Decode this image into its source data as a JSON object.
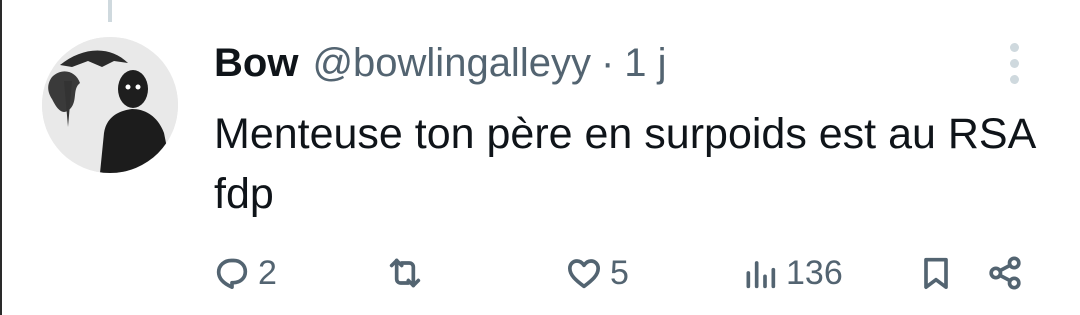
{
  "tweet": {
    "display_name": "Bow",
    "handle": "@bowlingalleyy",
    "separator": "·",
    "time": "1 j",
    "text": "Menteuse ton père en surpoids est au RSA fdp"
  },
  "actions": {
    "replies": "2",
    "retweets": "",
    "likes": "5",
    "views": "136"
  },
  "icons": {
    "reply": "reply-icon",
    "retweet": "retweet-icon",
    "like": "heart-icon",
    "views": "bar-chart-icon",
    "bookmark": "bookmark-icon",
    "share": "share-icon",
    "more": "more-vertical-icon"
  },
  "colors": {
    "text_primary": "#0f1419",
    "text_secondary": "#536471",
    "thread_line": "#cfd9de"
  }
}
